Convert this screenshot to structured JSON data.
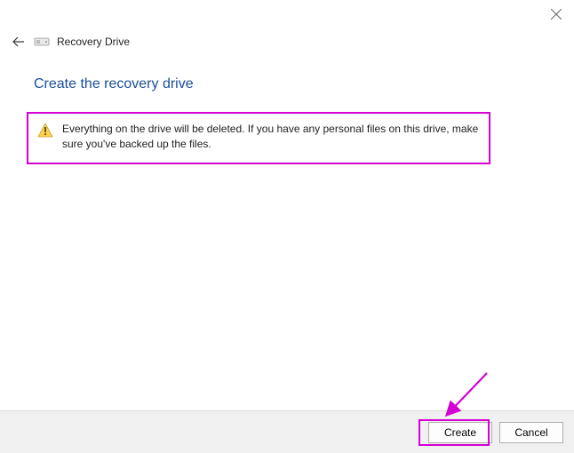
{
  "window": {
    "title": "Recovery Drive"
  },
  "page": {
    "heading": "Create the recovery drive"
  },
  "warning": {
    "text": "Everything on the drive will be deleted. If you have any personal files on this drive, make sure you've backed up the files."
  },
  "buttons": {
    "create": "Create",
    "cancel": "Cancel"
  },
  "accent_color": "#d400d4"
}
